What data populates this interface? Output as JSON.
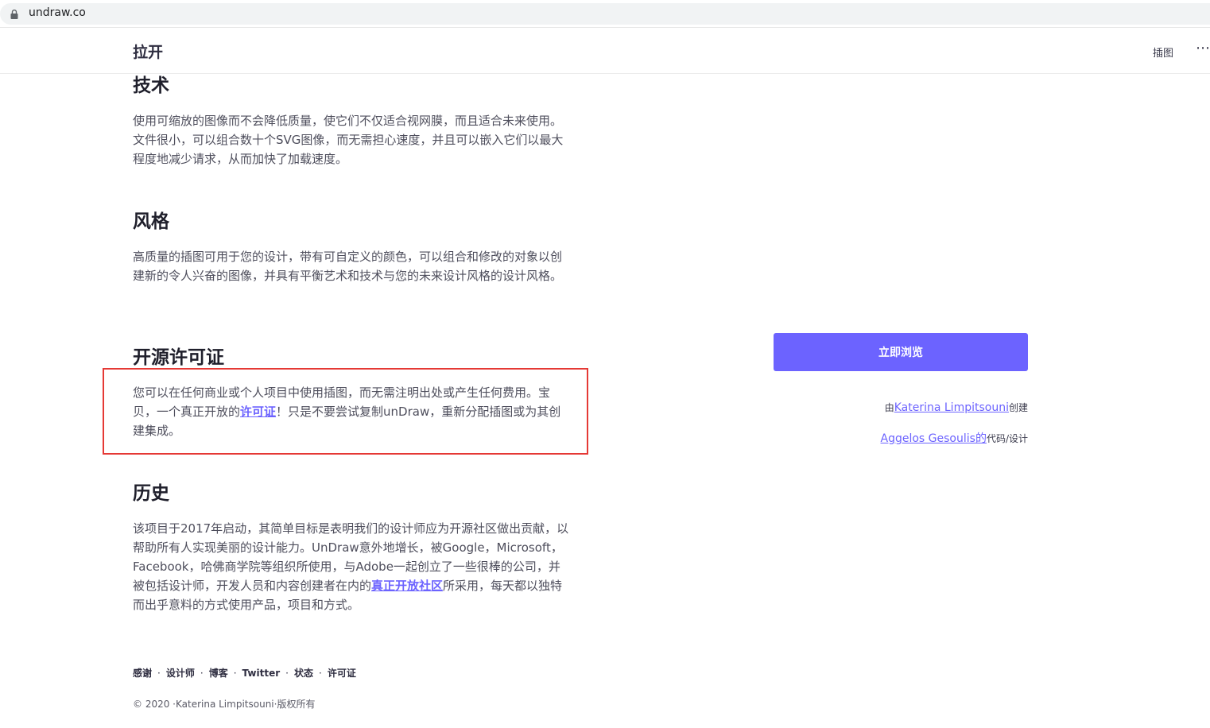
{
  "browser": {
    "url": "undraw.co"
  },
  "header": {
    "brand": "拉开",
    "nav_illustrations": "插图",
    "more": "⋯"
  },
  "sections": [
    {
      "heading": "技术",
      "body": "使用可缩放的图像而不会降低质量，使它们不仅适合视网膜，而且适合未来使用。文件很小，可以组合数十个SVG图像，而无需担心速度，并且可以嵌入它们以最大程度地减少请求，从而加快了加载速度。"
    },
    {
      "heading": "风格",
      "body": "高质量的插图可用于您的设计，带有可自定义的颜色，可以组合和修改的对象以创建新的令人兴奋的图像，并具有平衡艺术和技术与您的未来设计风格的设计风格。"
    },
    {
      "heading": "开源许可证",
      "body_before": "您可以在任何商业或个人项目中使用插图，而无需注明出处或产生任何费用。宝贝，一个真正开放的",
      "body_link": "许可证",
      "body_after": "！只是不要尝试复制unDraw，重新分配插图或为其创建集成。"
    },
    {
      "heading": "历史",
      "body_before": "该项目于2017年启动，其简单目标是表明我们的设计师应为开源社区做出贡献，以帮助所有人实现美丽的设计能力。UnDraw意外地增长，被Google，Microsoft，Facebook，哈佛商学院等组织所使用，与Adobe一起创立了一些很棒的公司，并被包括设计师，开发人员和内容创建者在内的",
      "body_link": "真正开放社区",
      "body_after": "所采用，每天都以独特而出乎意料的方式使用产品，项目和方式。"
    }
  ],
  "sidebar": {
    "browse_button": "立即浏览",
    "credit1_prefix": "由",
    "credit1_link": "Katerina Limpitsouni",
    "credit1_suffix": "创建",
    "credit2_link": "Aggelos Gesoulis的",
    "credit2_suffix": "代码/设计"
  },
  "footer": {
    "links": [
      "感谢",
      "设计师",
      "博客",
      "Twitter",
      "状态",
      "许可证"
    ],
    "copyright": "© 2020 ·Katerina Limpitsouni·版权所有"
  },
  "colors": {
    "accent": "#6c63ff",
    "highlight_border": "#e53935"
  }
}
